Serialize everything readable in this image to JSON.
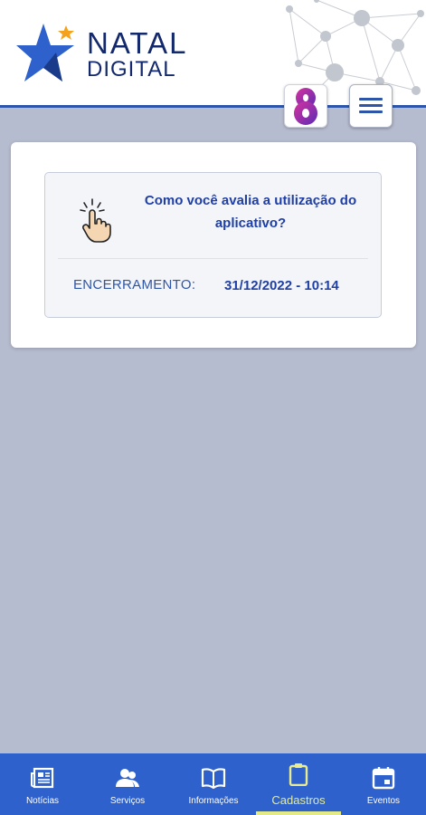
{
  "brand": {
    "line1": "NATAL",
    "line2": "DIGITAL"
  },
  "poll": {
    "question": "Como você avalia a utilização do aplicativo?",
    "closing_label": "ENCERRAMENTO:",
    "closing_value": "31/12/2022 - 10:14"
  },
  "nav": [
    {
      "label": "Notícias",
      "icon": "newspaper-icon"
    },
    {
      "label": "Serviços",
      "icon": "people-icon"
    },
    {
      "label": "Informações",
      "icon": "book-icon"
    },
    {
      "label": "Cadastros",
      "icon": "clipboard-icon",
      "active": true
    },
    {
      "label": "Eventos",
      "icon": "calendar-icon"
    }
  ],
  "colors": {
    "primary": "#2e61cc",
    "brand_dark": "#13296b",
    "active_nav": "#e9ec8e",
    "background": "#b6bccf"
  }
}
